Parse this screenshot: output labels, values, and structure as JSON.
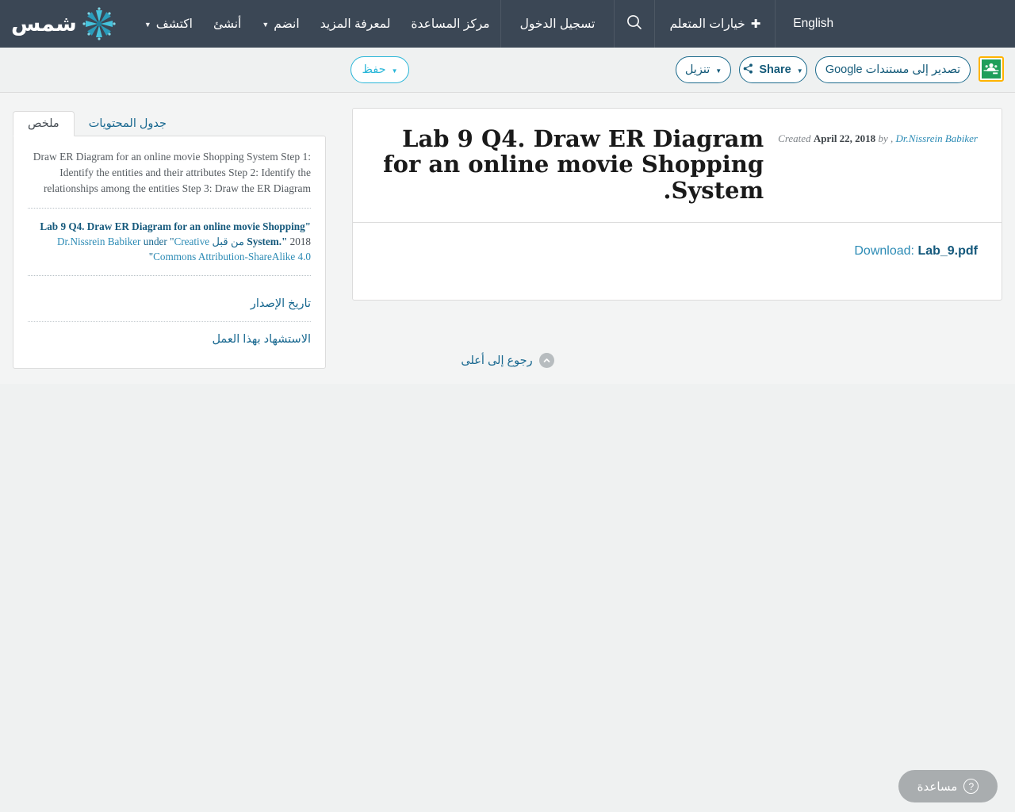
{
  "header": {
    "brand_name": "شمس",
    "brand_icon": "sunburst-logo-icon",
    "nav_items": [
      {
        "label": "اكتشف",
        "has_caret": true
      },
      {
        "label": "أنشئ",
        "has_caret": false
      },
      {
        "label": "انضم",
        "has_caret": true
      },
      {
        "label": "لمعرفة المزيد",
        "has_caret": false
      },
      {
        "label": "مركز المساعدة",
        "has_caret": false
      }
    ],
    "login_label": "تسجيل الدخول",
    "search_icon": "search-icon",
    "learner_options_label": "خيارات المتعلم",
    "learner_plus_icon": "plus-icon",
    "language_label": "English"
  },
  "toolbar": {
    "save_label": "حفظ",
    "download_label": "تنزيل",
    "share_label": "Share",
    "gdocs_label": "تصدير إلى مستندات Google",
    "classroom_icon": "google-classroom-icon",
    "save_color": "#29b6d8",
    "action_color": "#155b7a",
    "classroom_border_color": "#ffb400",
    "classroom_fill_color": "#1e9e5a"
  },
  "sidebar": {
    "tabs": [
      {
        "label": "جدول المحتويات",
        "active": false
      },
      {
        "label": "ملخص",
        "active": true
      }
    ],
    "abstract": "Draw ER Diagram for an online movie Shopping System Step 1: Identify the entities and their attributes Step 2: Identify the relationships among the entities Step 3: Draw the ER Diagram",
    "citation": {
      "quote_open": "\"",
      "title": "Lab 9 Q4. Draw ER Diagram for an online movie Shopping System.\"",
      "year": "2018",
      "by_label": "من قبل",
      "author": "Dr.Nissrein Babiker",
      "license_prefix": "under",
      "license": "Creative Commons Attribution-ShareAlike 4.0",
      "quote_close": "\""
    },
    "links": [
      {
        "label": "تاريخ الإصدار"
      },
      {
        "label": "الاستشهاد بهذا العمل"
      }
    ]
  },
  "main": {
    "created_label": "Created",
    "created_date": "April 22, 2018",
    "by_label": "by ,",
    "author": "Dr.Nissrein Babiker",
    "title": "Lab 9 Q4. Draw ER Diagram for an online movie Shopping System.",
    "download_label": "Download:",
    "download_file": "Lab_9.pdf"
  },
  "back_to_top": {
    "label": "رجوع إلى أعلى",
    "icon": "chevron-up-circle-icon"
  },
  "help": {
    "label": "مساعدة",
    "icon": "question-mark-icon"
  }
}
